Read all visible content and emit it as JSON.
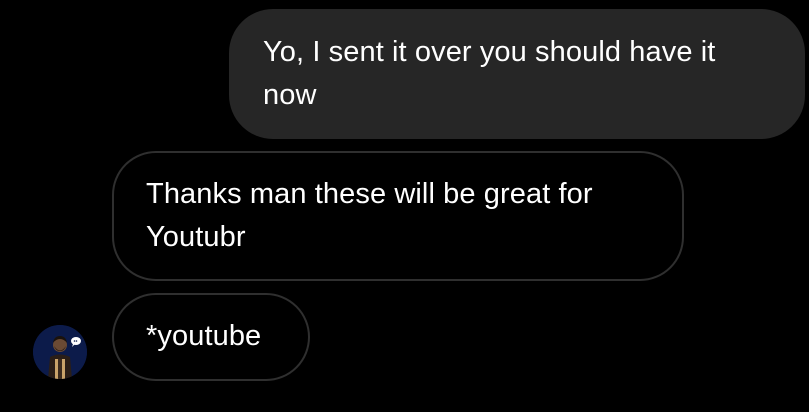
{
  "messages": [
    {
      "sender": "me",
      "text": "Yo, I sent it over you should have it now"
    },
    {
      "sender": "them",
      "text": "Thanks man these will be great for Youtubr"
    },
    {
      "sender": "them",
      "text": "*youtube"
    }
  ],
  "colors": {
    "background": "#000000",
    "sent_bubble": "#262626",
    "received_border": "#2f2f2f",
    "text": "#ffffff",
    "avatar_bg": "#0c1b4a"
  },
  "avatar": {
    "icon": "person-avatar-icon"
  }
}
